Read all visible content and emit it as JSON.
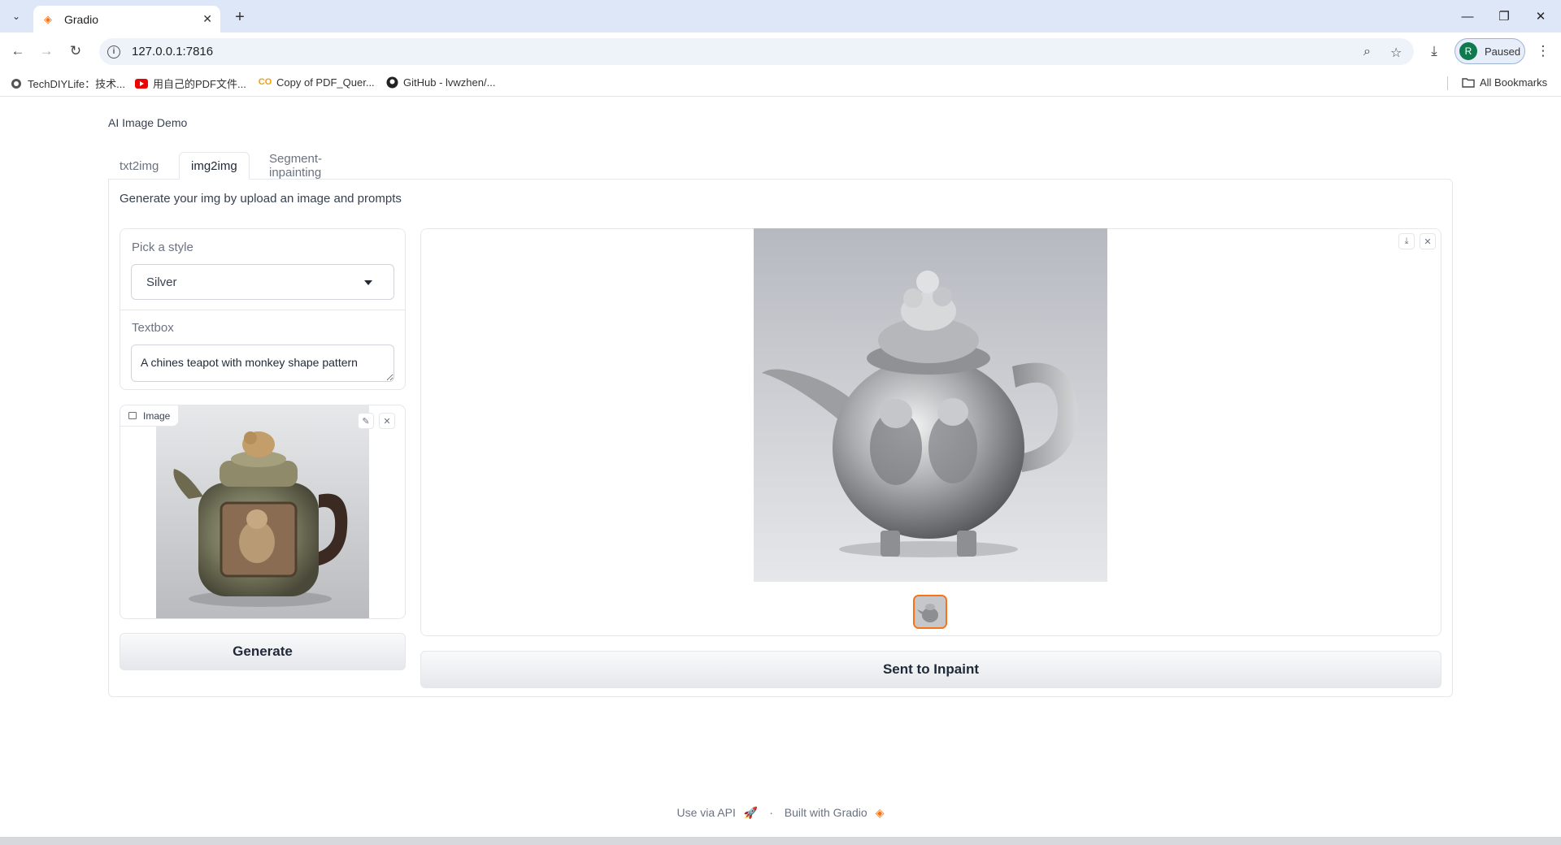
{
  "browser": {
    "tab_title": "Gradio",
    "new_tab_symbol": "+",
    "url": "127.0.0.1:7816",
    "profile_initial": "R",
    "profile_status": "Paused",
    "bookmarks": [
      {
        "label": "TechDIYLife：技术...",
        "icon": "globe-icon"
      },
      {
        "label": "用自己的PDF文件...",
        "icon": "youtube-icon"
      },
      {
        "label": "Copy of PDF_Quer...",
        "icon": "colab-icon"
      },
      {
        "label": "GitHub - lvwzhen/...",
        "icon": "github-icon"
      }
    ],
    "all_bookmarks": "All Bookmarks"
  },
  "app": {
    "title": "AI Image Demo",
    "tabs": [
      {
        "label": "txt2img",
        "active": false
      },
      {
        "label": "img2img",
        "active": true
      },
      {
        "label": "Segment-inpainting",
        "active": false
      }
    ],
    "description": "Generate your img by upload an image and prompts",
    "style_picker": {
      "label": "Pick a style",
      "value": "Silver"
    },
    "textbox": {
      "label": "Textbox",
      "value": "A chines teapot with monkey shape pattern"
    },
    "input_image": {
      "label": "Image"
    },
    "generate_button": "Generate",
    "send_button": "Sent to Inpaint",
    "accent_color": "#f97316"
  },
  "footer": {
    "api": "Use via API",
    "dot": "·",
    "built": "Built with Gradio"
  }
}
